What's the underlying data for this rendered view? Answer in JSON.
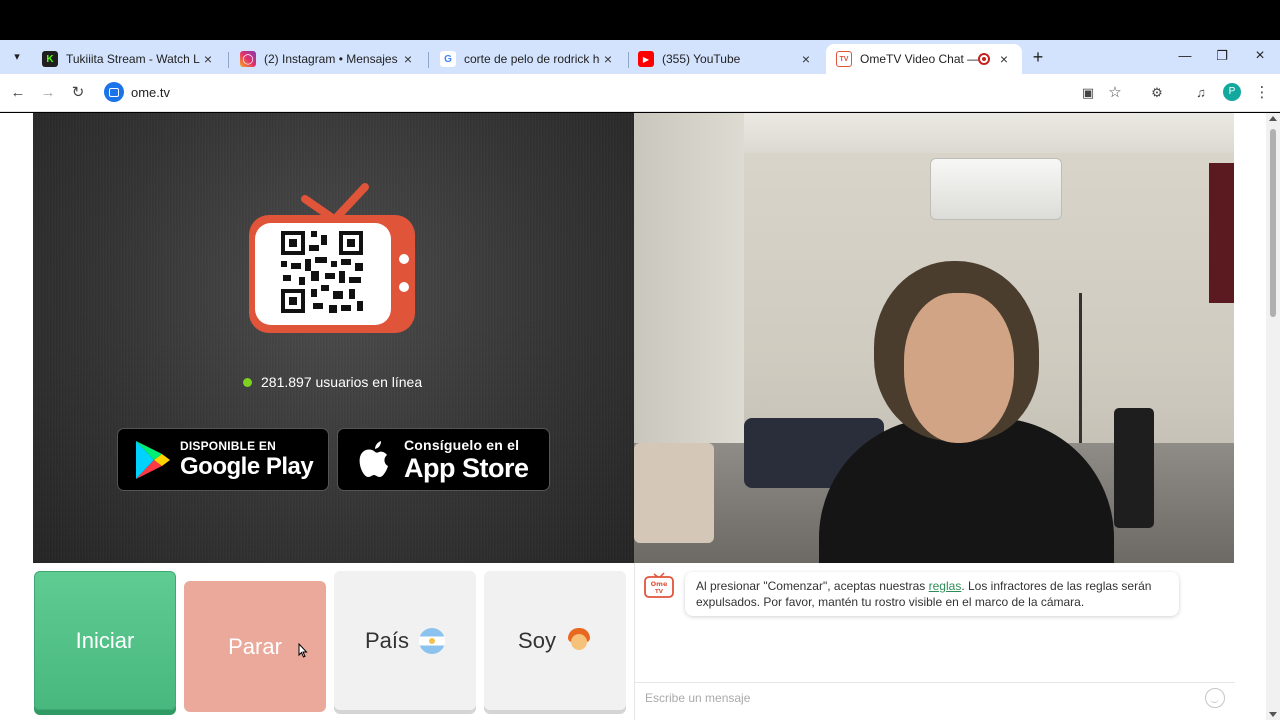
{
  "browser": {
    "tabs": [
      {
        "title": "Tukiiita Stream - Watch Live on",
        "favicon": "kick-icon",
        "active": false
      },
      {
        "title": "(2) Instagram • Mensajes",
        "favicon": "instagram-icon",
        "active": false
      },
      {
        "title": "corte de pelo de rodrick heffley",
        "favicon": "google-icon",
        "active": false
      },
      {
        "title": "(355) YouTube",
        "favicon": "youtube-icon",
        "active": false
      },
      {
        "title": "OmeTV Video Chat — Ome",
        "favicon": "ometv-icon",
        "active": true
      }
    ],
    "new_tab_label": "+",
    "url": "ome.tv",
    "profile_initial": "P"
  },
  "left_panel": {
    "online_count_text": "281.897 usuarios en línea",
    "online_dot_color": "#7ed321",
    "google_play": {
      "small": "DISPONIBLE EN",
      "big": "Google Play"
    },
    "app_store": {
      "small": "Consíguelo en el",
      "big": "App Store"
    }
  },
  "controls": {
    "start_label": "Iniciar",
    "stop_label": "Parar",
    "country_label": "País",
    "gender_label": "Soy"
  },
  "chat": {
    "notice_before": "Al presionar \"Comenzar\", aceptas nuestras ",
    "notice_link": "reglas",
    "notice_after": ". Los infractores de las reglas serán expulsados. Por favor, mantén tu rostro visible en el marco de la cámara.",
    "logo_text_top": "Ome",
    "logo_text_bottom": "TV",
    "input_placeholder": "Escribe un mensaje"
  },
  "colors": {
    "start_green": "#4fc085",
    "stop_salmon": "#eaa99a",
    "brand_red": "#e0543a",
    "tabstrip_blue": "#d3e3fd"
  }
}
